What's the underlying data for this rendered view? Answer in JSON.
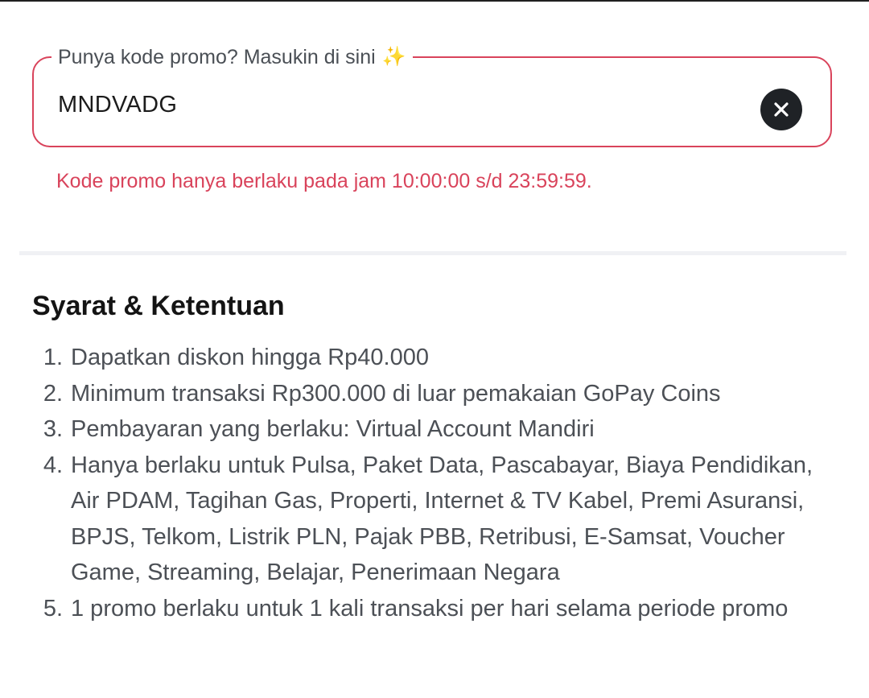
{
  "promo": {
    "legend": "Punya kode promo? Masukin di sini",
    "sparkle_icon": "✨",
    "value": "MNDVADG",
    "clear_icon": "close-icon",
    "error": "Kode promo hanya berlaku pada jam 10:00:00 s/d 23:59:59."
  },
  "terms": {
    "title": "Syarat & Ketentuan",
    "items": [
      {
        "num": "1.",
        "text": "Dapatkan diskon hingga Rp40.000"
      },
      {
        "num": "2.",
        "text": "Minimum transaksi Rp300.000 di luar pemakaian GoPay Coins"
      },
      {
        "num": "3.",
        "text": "Pembayaran yang berlaku: Virtual Account Mandiri"
      },
      {
        "num": "4.",
        "text": "Hanya berlaku untuk Pulsa, Paket Data, Pascabayar, Biaya Pendidikan, Air PDAM, Tagihan Gas, Properti, Internet & TV Kabel, Premi Asuransi, BPJS, Telkom, Listrik PLN, Pajak PBB, Retribusi, E-Samsat, Voucher Game, Streaming, Belajar, Penerimaan Negara"
      },
      {
        "num": "5.",
        "text": "1 promo berlaku untuk 1 kali transaksi per hari selama periode promo"
      }
    ]
  },
  "colors": {
    "error": "#d9435b",
    "text_primary": "#141414",
    "text_secondary": "#4c5056",
    "clear_button_bg": "#1f2226"
  }
}
